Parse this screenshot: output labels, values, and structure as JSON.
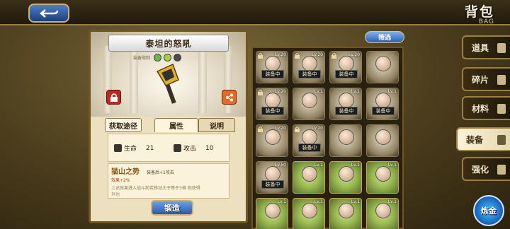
{
  "header": {
    "title": "背包",
    "subtitle": "BAG"
  },
  "item": {
    "name": "泰坦的怒吼",
    "tag": "装备限制",
    "tabs": {
      "get": "获取途径",
      "attr": "属性",
      "desc": "说明"
    },
    "stats": [
      {
        "label": "生命",
        "value": "21",
        "icon": "heart-icon"
      },
      {
        "label": "攻击",
        "value": "10",
        "icon": "sword-icon"
      }
    ],
    "skill": {
      "name": "猫山之势",
      "tag": "装备后+1攻击",
      "line2": "效果+2%",
      "line3": "上述效果进入战斗前若移动大于等于3格  则获得",
      "line4": "其他"
    },
    "forge_label": "锻造"
  },
  "filter_label": "筛选",
  "grid": [
    {
      "lv": "Lv.20",
      "badge": "装备中",
      "locked": true,
      "style": "plain"
    },
    {
      "lv": "Lv.20",
      "badge": "装备中",
      "locked": true,
      "style": "plain"
    },
    {
      "lv": "Lv.20",
      "badge": "装备中",
      "locked": true,
      "style": "plain"
    },
    {
      "lv": "",
      "badge": "",
      "locked": false,
      "style": "plain"
    },
    {
      "lv": "Lv.20",
      "badge": "装备中",
      "locked": true,
      "style": "plain"
    },
    {
      "lv": "Lv.1",
      "badge": "",
      "locked": false,
      "style": "plain"
    },
    {
      "lv": "Lv.1",
      "badge": "装备中",
      "locked": false,
      "style": "plain"
    },
    {
      "lv": "Lv.1",
      "badge": "装备中",
      "locked": false,
      "style": "plain"
    },
    {
      "lv": "Lv.20",
      "badge": "",
      "locked": true,
      "style": "plain"
    },
    {
      "lv": "Lv.20",
      "badge": "装备中",
      "locked": true,
      "style": "plain"
    },
    {
      "lv": "",
      "badge": "",
      "locked": false,
      "style": "plain"
    },
    {
      "lv": "",
      "badge": "",
      "locked": false,
      "style": "plain"
    },
    {
      "lv": "Lv.50",
      "badge": "装备中",
      "locked": false,
      "style": "plain"
    },
    {
      "lv": "Lv.1",
      "badge": "",
      "locked": false,
      "style": "gold"
    },
    {
      "lv": "Lv.1",
      "badge": "",
      "locked": false,
      "style": "gold"
    },
    {
      "lv": "Lv.1",
      "badge": "",
      "locked": false,
      "style": "gold"
    },
    {
      "lv": "Lv.1",
      "badge": "",
      "locked": false,
      "style": "gold"
    },
    {
      "lv": "Lv.1",
      "badge": "",
      "locked": false,
      "style": "gold"
    },
    {
      "lv": "Lv.1",
      "badge": "",
      "locked": false,
      "style": "gold"
    },
    {
      "lv": "Lv.1",
      "badge": "",
      "locked": false,
      "style": "gold"
    }
  ],
  "menu": [
    {
      "label": "道具",
      "active": false,
      "icon": "potion-icon"
    },
    {
      "label": "碎片",
      "active": false,
      "icon": "shard-icon"
    },
    {
      "label": "材料",
      "active": false,
      "icon": "bag-icon"
    },
    {
      "label": "装备",
      "active": true,
      "icon": "sword-icon"
    },
    {
      "label": "强化",
      "active": false,
      "icon": "upgrade-icon"
    }
  ],
  "fire_label": "炼金",
  "colors": {
    "accent_blue": "#2f5fb0",
    "panel_bg": "#ece0bf",
    "frame_gold": "#9b7f45"
  }
}
